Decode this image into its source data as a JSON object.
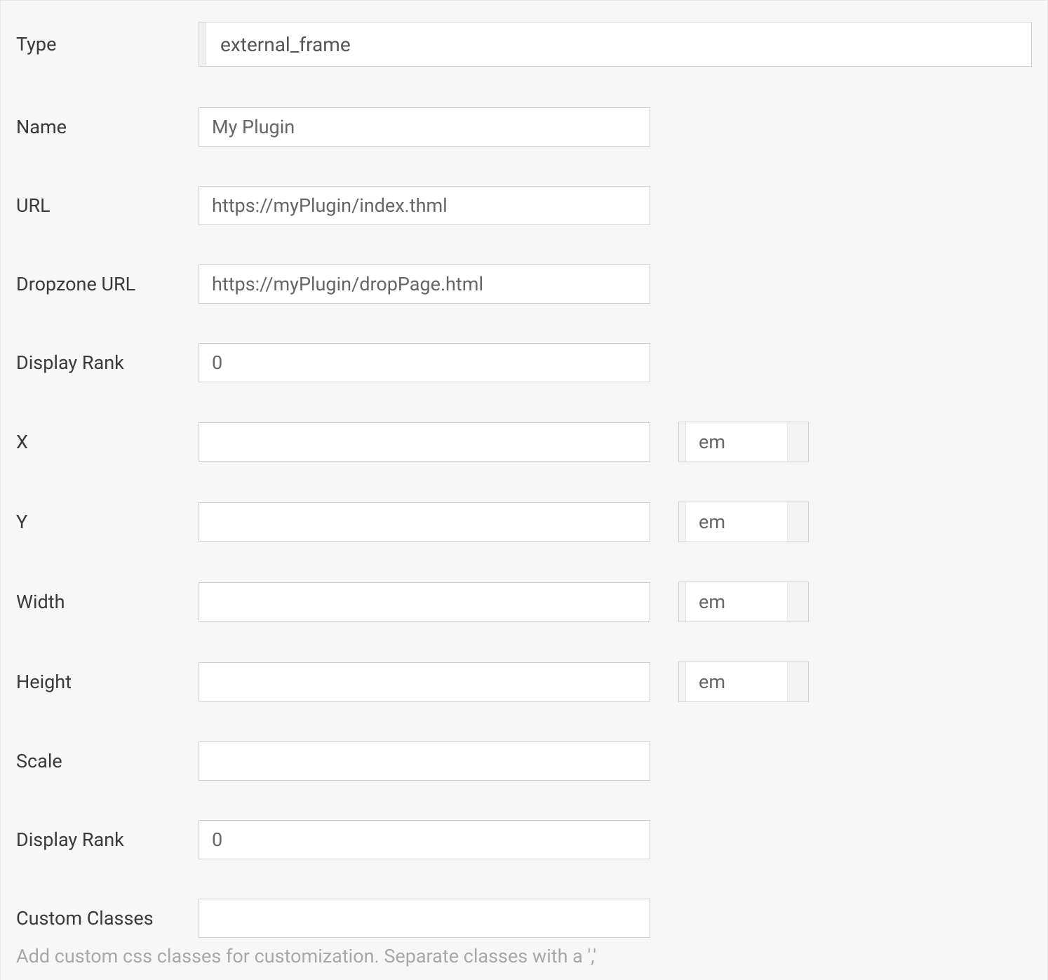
{
  "form": {
    "type": {
      "label": "Type",
      "value": "external_frame"
    },
    "name": {
      "label": "Name",
      "value": "My Plugin"
    },
    "url": {
      "label": "URL",
      "value": "https://myPlugin/index.thml"
    },
    "dropzoneUrl": {
      "label": "Dropzone URL",
      "value": "https://myPlugin/dropPage.html"
    },
    "displayRank1": {
      "label": "Display Rank",
      "value": "0"
    },
    "x": {
      "label": "X",
      "value": "",
      "unit": "em"
    },
    "y": {
      "label": "Y",
      "value": "",
      "unit": "em"
    },
    "width": {
      "label": "Width",
      "value": "",
      "unit": "em"
    },
    "height": {
      "label": "Height",
      "value": "",
      "unit": "em"
    },
    "scale": {
      "label": "Scale",
      "value": ""
    },
    "displayRank2": {
      "label": "Display Rank",
      "value": "0"
    },
    "customClasses": {
      "label": "Custom Classes",
      "value": "",
      "help": "Add custom css classes for customization. Separate classes with a ','"
    }
  }
}
